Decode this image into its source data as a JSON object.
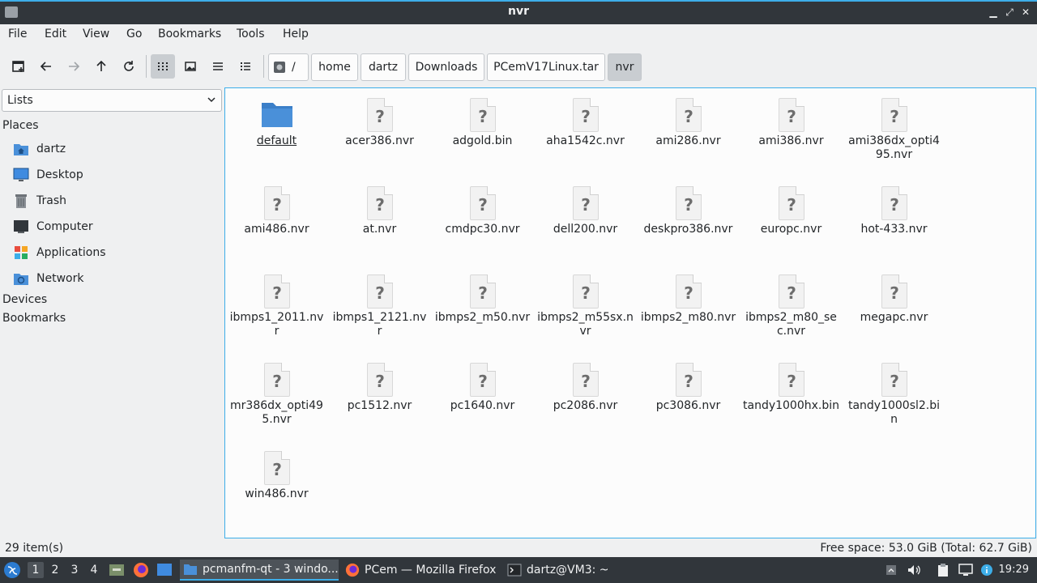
{
  "window": {
    "title": "nvr"
  },
  "menu": [
    "File",
    "Edit",
    "View",
    "Go",
    "Bookmarks",
    "Tools",
    "Help"
  ],
  "breadcrumb": {
    "root": "/",
    "segments": [
      "home",
      "dartz",
      "Downloads",
      "PCemV17Linux.tar",
      "nvr"
    ]
  },
  "sidebar": {
    "view_mode": "Lists",
    "places_header": "Places",
    "places": [
      {
        "label": "dartz",
        "icon": "home-folder-icon"
      },
      {
        "label": "Desktop",
        "icon": "desktop-icon"
      },
      {
        "label": "Trash",
        "icon": "trash-icon"
      },
      {
        "label": "Computer",
        "icon": "computer-icon"
      },
      {
        "label": "Applications",
        "icon": "applications-icon"
      },
      {
        "label": "Network",
        "icon": "network-icon"
      }
    ],
    "devices_header": "Devices",
    "bookmarks_header": "Bookmarks"
  },
  "files": [
    {
      "name": "default",
      "type": "folder"
    },
    {
      "name": "acer386.nvr",
      "type": "file"
    },
    {
      "name": "adgold.bin",
      "type": "file"
    },
    {
      "name": "aha1542c.nvr",
      "type": "file"
    },
    {
      "name": "ami286.nvr",
      "type": "file"
    },
    {
      "name": "ami386.nvr",
      "type": "file"
    },
    {
      "name": "ami386dx_opti495.nvr",
      "type": "file"
    },
    {
      "name": "ami486.nvr",
      "type": "file"
    },
    {
      "name": "at.nvr",
      "type": "file"
    },
    {
      "name": "cmdpc30.nvr",
      "type": "file"
    },
    {
      "name": "dell200.nvr",
      "type": "file"
    },
    {
      "name": "deskpro386.nvr",
      "type": "file"
    },
    {
      "name": "europc.nvr",
      "type": "file"
    },
    {
      "name": "hot-433.nvr",
      "type": "file"
    },
    {
      "name": "ibmps1_2011.nvr",
      "type": "file"
    },
    {
      "name": "ibmps1_2121.nvr",
      "type": "file"
    },
    {
      "name": "ibmps2_m50.nvr",
      "type": "file"
    },
    {
      "name": "ibmps2_m55sx.nvr",
      "type": "file"
    },
    {
      "name": "ibmps2_m80.nvr",
      "type": "file"
    },
    {
      "name": "ibmps2_m80_sec.nvr",
      "type": "file"
    },
    {
      "name": "megapc.nvr",
      "type": "file"
    },
    {
      "name": "mr386dx_opti495.nvr",
      "type": "file"
    },
    {
      "name": "pc1512.nvr",
      "type": "file"
    },
    {
      "name": "pc1640.nvr",
      "type": "file"
    },
    {
      "name": "pc2086.nvr",
      "type": "file"
    },
    {
      "name": "pc3086.nvr",
      "type": "file"
    },
    {
      "name": "tandy1000hx.bin",
      "type": "file"
    },
    {
      "name": "tandy1000sl2.bin",
      "type": "file"
    },
    {
      "name": "win486.nvr",
      "type": "file"
    }
  ],
  "status": {
    "count": "29 item(s)",
    "free_space": "Free space: 53.0 GiB (Total: 62.7 GiB)"
  },
  "taskbar": {
    "desktops": [
      "1",
      "2",
      "3",
      "4"
    ],
    "active_desktop": "1",
    "tasks": [
      {
        "label": "pcmanfm-qt - 3 windo...",
        "icon": "folder-icon"
      },
      {
        "label": "PCem — Mozilla Firefox",
        "icon": "firefox-icon"
      },
      {
        "label": "dartz@VM3: ~",
        "icon": "terminal-icon"
      }
    ],
    "clock": "19:29"
  },
  "colors": {
    "accent": "#3daee9",
    "titlebar": "#31363b",
    "folder": "#4a90d9"
  }
}
